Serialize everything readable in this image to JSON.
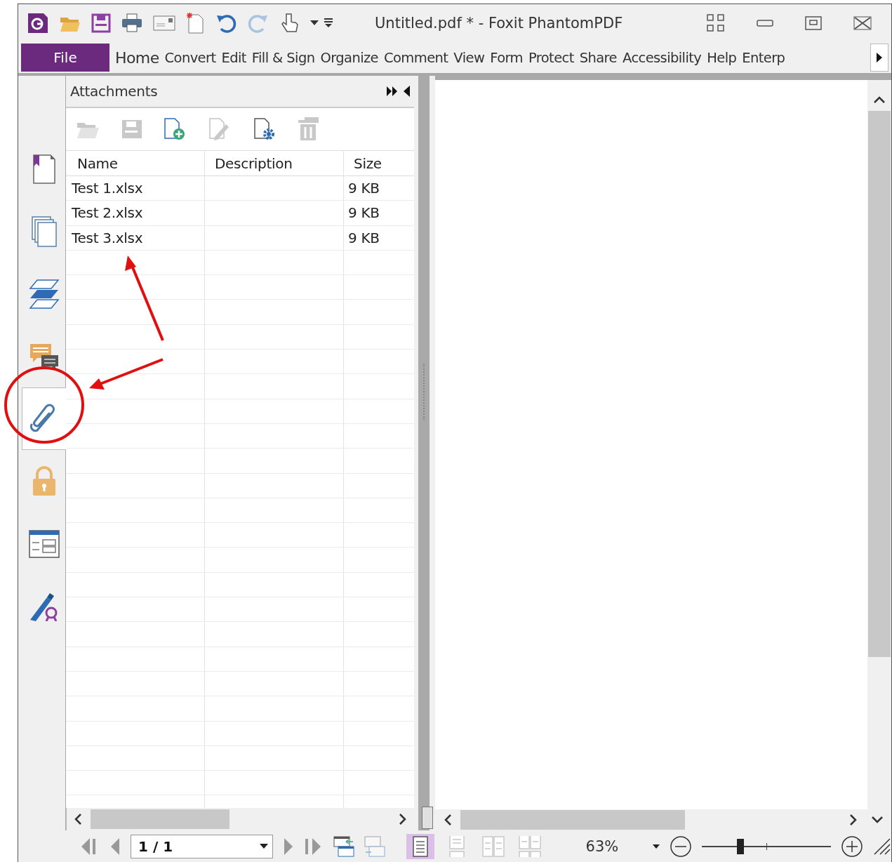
{
  "window": {
    "title": "Untitled.pdf * - Foxit PhantomPDF"
  },
  "file_button": "File",
  "ribbon_tabs": [
    "Home",
    "Convert",
    "Edit",
    "Fill & Sign",
    "Organize",
    "Comment",
    "View",
    "Form",
    "Protect",
    "Share",
    "Accessibility",
    "Help",
    "Enterp"
  ],
  "sidebar": {
    "items": [
      {
        "kind": "bookmarks",
        "selected": false
      },
      {
        "kind": "pages",
        "selected": false
      },
      {
        "kind": "layers",
        "selected": false
      },
      {
        "kind": "comments",
        "selected": false
      },
      {
        "kind": "attachments",
        "selected": true
      },
      {
        "kind": "security",
        "selected": false
      },
      {
        "kind": "form",
        "selected": false
      },
      {
        "kind": "signatures",
        "selected": false
      }
    ]
  },
  "attachments_panel": {
    "title": "Attachments",
    "toolbar": [
      {
        "kind": "open",
        "disabled": true
      },
      {
        "kind": "save",
        "disabled": true
      },
      {
        "kind": "add",
        "disabled": false
      },
      {
        "kind": "edit",
        "disabled": true
      },
      {
        "kind": "properties",
        "disabled": false
      },
      {
        "kind": "delete",
        "disabled": true
      }
    ],
    "columns": [
      "Name",
      "Description",
      "Size"
    ],
    "rows": [
      {
        "name": "Test 1.xlsx",
        "size": "9 KB"
      },
      {
        "name": "Test 2.xlsx",
        "size": "9 KB"
      },
      {
        "name": "Test 3.xlsx",
        "size": "9 KB"
      }
    ]
  },
  "status_bar": {
    "page": "1 / 1",
    "view_modes": [
      {
        "kind": "single",
        "selected": true
      },
      {
        "kind": "continuous",
        "selected": false
      },
      {
        "kind": "facing",
        "selected": false
      },
      {
        "kind": "continuous-facing",
        "selected": false
      }
    ],
    "zoom": "63%",
    "zoom_slider": {
      "level": 0.3
    }
  }
}
